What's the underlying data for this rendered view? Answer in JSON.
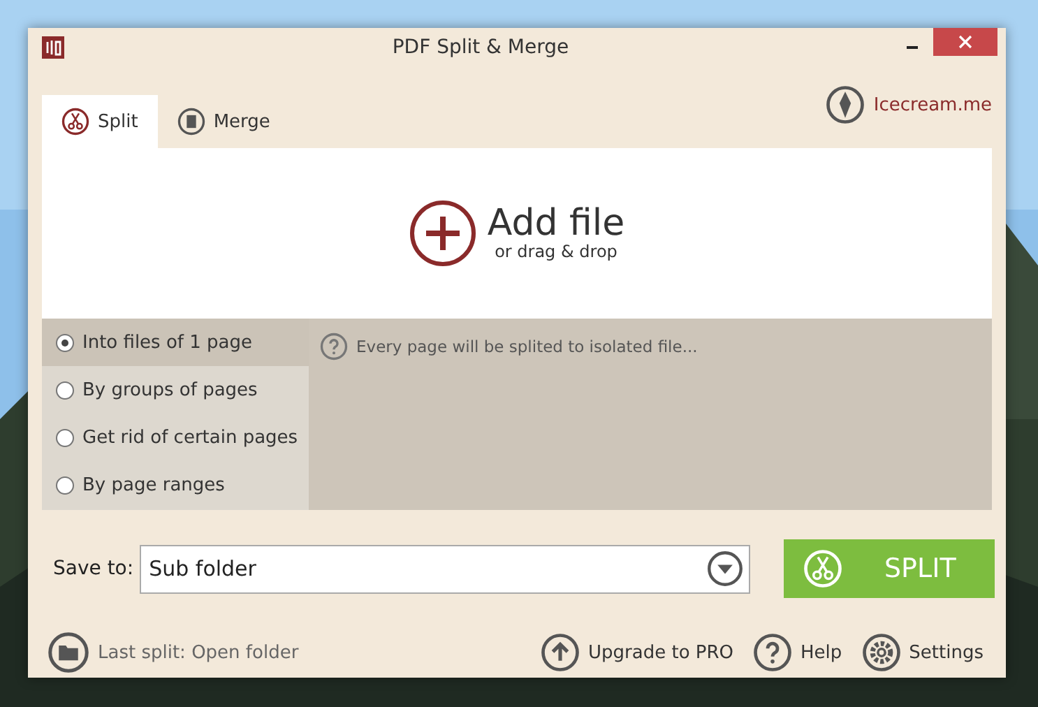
{
  "window": {
    "title": "PDF Split & Merge"
  },
  "tabs": [
    {
      "label": "Split",
      "selected": true,
      "kind": "split"
    },
    {
      "label": "Merge",
      "selected": false,
      "kind": "merge"
    }
  ],
  "brand_link": "Icecream.me",
  "add_file": {
    "title": "Add file",
    "subtitle": "or drag & drop"
  },
  "split_modes": [
    {
      "label": "Into files of 1 page",
      "selected": true
    },
    {
      "label": "By groups of pages",
      "selected": false
    },
    {
      "label": "Get rid of certain pages",
      "selected": false
    },
    {
      "label": "By page ranges",
      "selected": false
    }
  ],
  "hint": "Every page will be splited to isolated file...",
  "save_to": {
    "label": "Save to:",
    "value": "Sub folder"
  },
  "split_button": "SPLIT",
  "footer": {
    "last_split": "Last split: Open folder",
    "links": [
      {
        "label": "Upgrade to PRO",
        "kind": "upgrade"
      },
      {
        "label": "Help",
        "kind": "help"
      },
      {
        "label": "Settings",
        "kind": "settings"
      }
    ]
  }
}
